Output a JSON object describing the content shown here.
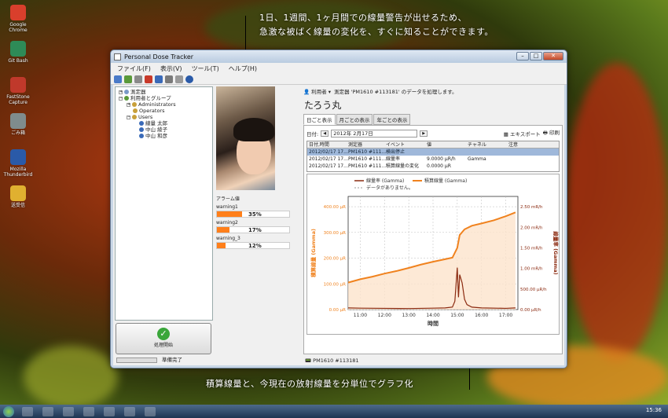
{
  "annotations": {
    "top_line1": "1日、1週間、1ヶ月間での線量警告が出せるため、",
    "top_line2": "急激な被ばく線量の変化を、すぐに知ることができます。",
    "bottom": "積算線量と、今現在の放射線量を分単位でグラフ化"
  },
  "desktop_icons": [
    {
      "label": "Google Chrome",
      "color": "#d93f2c"
    },
    {
      "label": "Git Bash",
      "color": "#2e8b57"
    },
    {
      "label": "FastStone Capture",
      "color": "#c0392b"
    },
    {
      "label": "ごみ箱",
      "color": "#7f8c8d"
    },
    {
      "label": "Mozilla Thunderbird",
      "color": "#2a5aa8"
    },
    {
      "label": "送受信",
      "color": "#e0b030"
    }
  ],
  "window": {
    "title": "Personal Dose Tracker",
    "menu": [
      "ファイル(F)",
      "表示(V)",
      "ツール(T)",
      "ヘルプ(H)"
    ]
  },
  "tree": {
    "root1": "測定器",
    "root2": "利用者とグループ",
    "group_admin": "Administrators",
    "group_operators": "Operators",
    "group_users": "Users",
    "users": [
      "線量 太郎",
      "中山 綾子",
      "中山 和彦"
    ]
  },
  "start_button": {
    "label": "処理開始"
  },
  "alarm": {
    "title": "アラーム値",
    "items": [
      {
        "label": "warning1",
        "value": "35%",
        "fraction": 0.35
      },
      {
        "label": "warning2",
        "value": "17%",
        "fraction": 0.17
      },
      {
        "label": "warning_3",
        "value": "12%",
        "fraction": 0.12
      }
    ]
  },
  "detail": {
    "source_user": "利用者",
    "source_text": "測定器 'PM1610 #113181' のデータを処理します。",
    "person_name": "たろう丸",
    "tabs": [
      "日ごと表示",
      "月ごとの表示",
      "年ごとの表示"
    ],
    "date_label": "日付:",
    "date_value": "2012年 2月17日",
    "export_label": "エキスポート",
    "print_label": "印刷"
  },
  "table": {
    "headers": [
      "日付,時間",
      "測定器",
      "イベント",
      "値",
      "チャネル",
      "注意"
    ],
    "rows": [
      [
        "2012/02/17 17...",
        "PM1610 #111...",
        "検出停止",
        "",
        "",
        ""
      ],
      [
        "2012/02/17 17...",
        "PM1610 #111...",
        "線量率",
        "9.0000 µR/h",
        "Gamma",
        ""
      ],
      [
        "2012/02/17 17...",
        "PM1610 #111...",
        "積算線量の変化",
        "0.0000 µR",
        "",
        ""
      ]
    ]
  },
  "chart_data": {
    "type": "line",
    "legend": [
      "線量率 (Gamma)",
      "積算線量 (Gamma)",
      "データがありません。"
    ],
    "xlabel": "時間",
    "ylabel_left": "積算線量 (Gamma)",
    "ylabel_right": "線量率 (Gamma)",
    "xticks": [
      "11:00",
      "12:00",
      "13:00",
      "14:00",
      "15:00",
      "16:00",
      "17:00"
    ],
    "yticks_left": [
      "0.00 µR",
      "100.00 µR",
      "200.00 µR",
      "300.00 µR",
      "400.00 µR"
    ],
    "yticks_right": [
      "0.00 µR/h",
      "500.00 µR/h",
      "1.00 mR/h",
      "1.50 mR/h",
      "2.00 mR/h",
      "2.50 mR/h"
    ],
    "xlim": [
      10.5,
      17.5
    ],
    "ylim_left": [
      0,
      440
    ],
    "ylim_right": [
      0,
      2750
    ],
    "series": [
      {
        "name": "積算線量 (Gamma)",
        "axis": "left",
        "x": [
          10.5,
          11,
          11.5,
          12,
          12.5,
          13,
          13.5,
          14,
          14.5,
          14.8,
          15.0,
          15.1,
          15.3,
          15.6,
          16,
          16.5,
          17,
          17.4
        ],
        "y": [
          105,
          118,
          128,
          140,
          150,
          162,
          175,
          186,
          196,
          202,
          240,
          290,
          312,
          326,
          335,
          347,
          363,
          378
        ]
      },
      {
        "name": "線量率 (Gamma)",
        "axis": "right",
        "x": [
          10.5,
          11,
          12,
          13,
          14,
          14.5,
          14.8,
          14.9,
          15.0,
          15.05,
          15.1,
          15.2,
          15.3,
          15.4,
          15.6,
          16,
          17,
          17.4
        ],
        "y": [
          40,
          35,
          30,
          25,
          35,
          40,
          60,
          200,
          1020,
          300,
          850,
          650,
          250,
          120,
          60,
          40,
          30,
          40
        ]
      }
    ],
    "colors": {
      "cumulative": "#f0821e",
      "rate": "#8b2a10",
      "fill": "#fde4cc"
    }
  },
  "status": {
    "device": "PM1610 #113181",
    "ready": "準備完了"
  },
  "taskbar": {
    "clock": "15:36"
  }
}
